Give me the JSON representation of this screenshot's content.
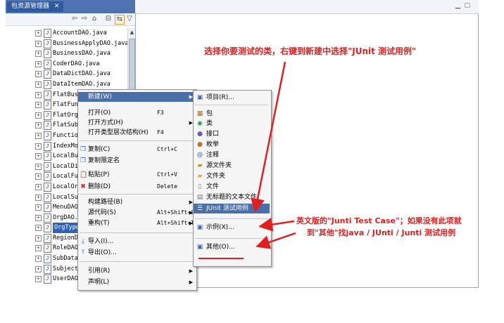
{
  "view_tab": {
    "title": "包资源管理器",
    "close": "✕"
  },
  "toolbar": {
    "icons": [
      "back-icon",
      "forward-icon",
      "home-icon",
      "collapse-all-icon",
      "link-editor-icon",
      "view-menu-icon"
    ]
  },
  "tree": {
    "rows": [
      {
        "name": "AccountDAO.java",
        "selected": false
      },
      {
        "name": "BusinessApplyDAO.java",
        "selected": false
      },
      {
        "name": "BusinessDAO.java",
        "selected": false
      },
      {
        "name": "CoderDAO.java",
        "selected": false
      },
      {
        "name": "DataDictDAO.java",
        "selected": false
      },
      {
        "name": "DataItemDAO.java",
        "selected": false
      },
      {
        "name": "FlatBusi",
        "selected": false
      },
      {
        "name": "FlatFunc",
        "selected": false
      },
      {
        "name": "FlatOrgR",
        "selected": false
      },
      {
        "name": "FlatSubj",
        "selected": false
      },
      {
        "name": "Function",
        "selected": false
      },
      {
        "name": "IndexMod",
        "selected": false
      },
      {
        "name": "LocalBus",
        "selected": false
      },
      {
        "name": "LocalDir",
        "selected": false
      },
      {
        "name": "LocalFun",
        "selected": false
      },
      {
        "name": "LocalOrg",
        "selected": false
      },
      {
        "name": "LocalSub",
        "selected": false
      },
      {
        "name": "MenuDAO.",
        "selected": false
      },
      {
        "name": "OrgDAO.j",
        "selected": false
      },
      {
        "name": "OrgTypeD",
        "selected": true
      },
      {
        "name": "RegionDA",
        "selected": false
      },
      {
        "name": "RoleDAO.",
        "selected": false
      },
      {
        "name": "SubDataB",
        "selected": false
      },
      {
        "name": "SubjectD",
        "selected": false
      },
      {
        "name": "UserDAO.",
        "selected": false
      }
    ]
  },
  "context_menu": {
    "new": "新建(W)",
    "open": "打开(O)",
    "open_acc": "F3",
    "open_with": "打开方式(H)",
    "open_type_hierarchy": "打开类型层次结构(H)",
    "open_type_hierarchy_acc": "F4",
    "copy": "复制(C)",
    "copy_acc": "Ctrl+C",
    "copy_qualified": "复制限定名",
    "paste": "粘贴(P)",
    "paste_acc": "Ctrl+V",
    "delete": "删除(D)",
    "delete_acc": "Delete",
    "build_path": "构建路径(B)",
    "source": "源代码(S)",
    "source_acc": "Alt+Shift+S",
    "refactor": "重构(T)",
    "refactor_acc": "Alt+Shift+T",
    "import": "导入(I)...",
    "export": "导出(O)...",
    "references": "引用(R)",
    "declarations": "声明(L)"
  },
  "submenu": {
    "project": "项目(R)...",
    "package": "包",
    "class": "类",
    "interface": "接口",
    "enum": "枚举",
    "annotation": "注释",
    "source_folder": "源文件夹",
    "folder": "文件夹",
    "file": "文件",
    "untitled_text_file": "无标题的文本文件",
    "junit_test_case": "JUnit 测试用例",
    "example": "示例(X)...",
    "other": "其他(O)..."
  },
  "annotations": {
    "top": "选择你要测试的类，右键到新建中选择\"JUnit 测试用例\"",
    "side_line1": "英文版的\"Junti Test Case\"；如果没有此项就",
    "side_line2": "到\"其他\"找java / JUnti / Junti 测试用例"
  },
  "colors": {
    "annotation_red": "#e02020",
    "selection_blue": "#3063b4",
    "menu_highlight": "#4a6ea9"
  }
}
